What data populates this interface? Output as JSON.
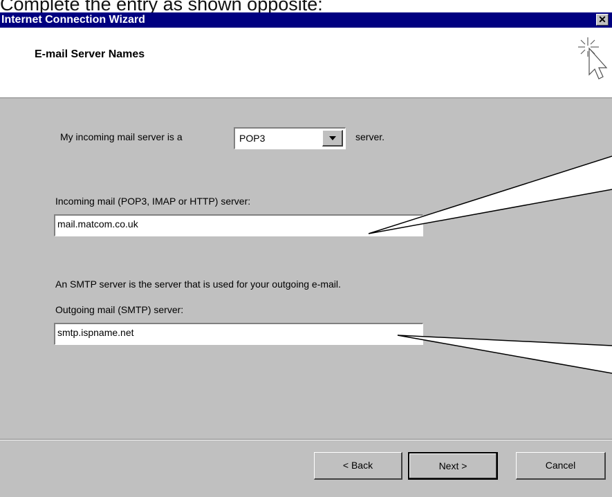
{
  "caption": "Complete the entry as shown opposite:",
  "window": {
    "title": "Internet Connection Wizard",
    "close_glyph": "✕"
  },
  "header": {
    "title": "E-mail Server Names",
    "graphic_icon": "sparkle-cursor-icon"
  },
  "incoming_type": {
    "label": "My incoming mail server is a",
    "selected": "POP3",
    "suffix": "server."
  },
  "incoming": {
    "label": "Incoming mail (POP3, IMAP or HTTP) server:",
    "value": "mail.matcom.co.uk"
  },
  "smtp_note": "An SMTP server is the server that is used for your outgoing e-mail.",
  "outgoing": {
    "label": "Outgoing mail (SMTP) server:",
    "value": "smtp.ispname.net"
  },
  "buttons": {
    "back": "< Back",
    "next": "Next >",
    "cancel": "Cancel"
  },
  "colors": {
    "title_bar": "#000080",
    "dialog_face": "#c0c0c0"
  }
}
